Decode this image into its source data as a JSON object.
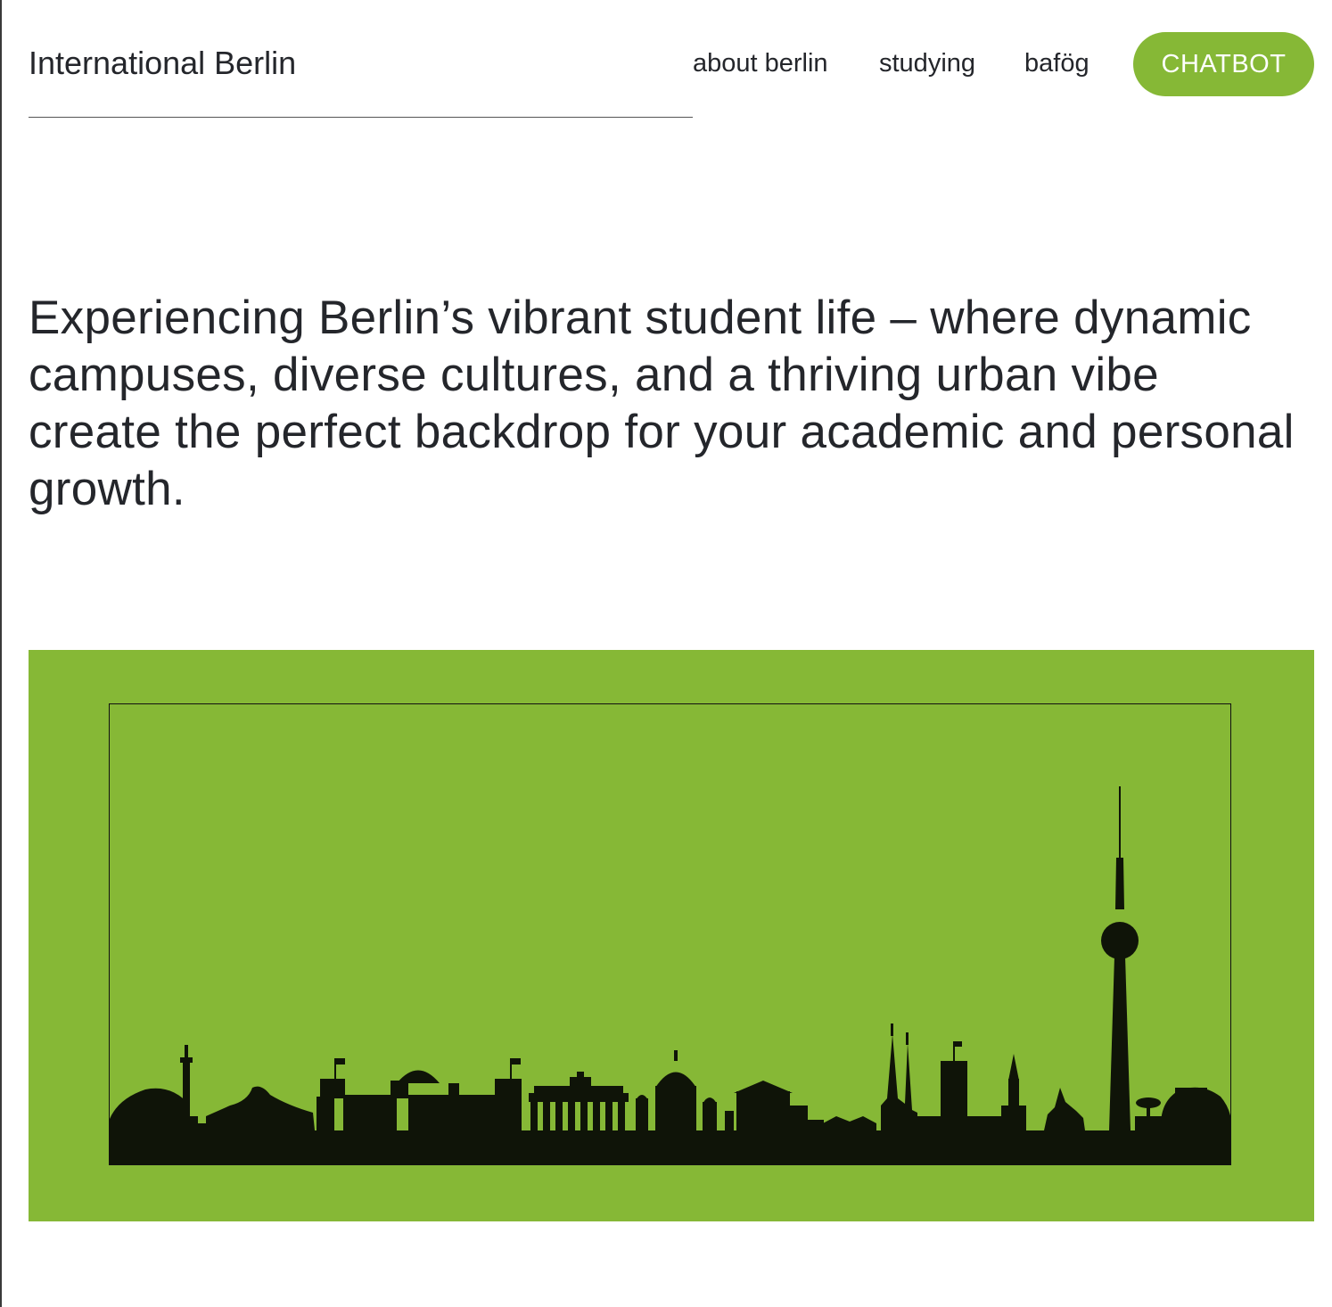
{
  "header": {
    "site_title": "International Berlin",
    "nav": {
      "about": "about berlin",
      "studying": "studying",
      "bafoeg": "bafög"
    },
    "chatbot_label": "CHATBOT"
  },
  "hero": {
    "text": "Experiencing Berlin’s vibrant student life – where dynamic campuses, diverse cultures, and a thriving urban vibe create the perfect backdrop for your academic and personal growth."
  },
  "banner": {
    "image": "berlin-skyline-silhouette",
    "background_color": "#86b836",
    "silhouette_color": "#0f1408"
  },
  "colors": {
    "accent": "#86b836",
    "text": "#24262b"
  }
}
